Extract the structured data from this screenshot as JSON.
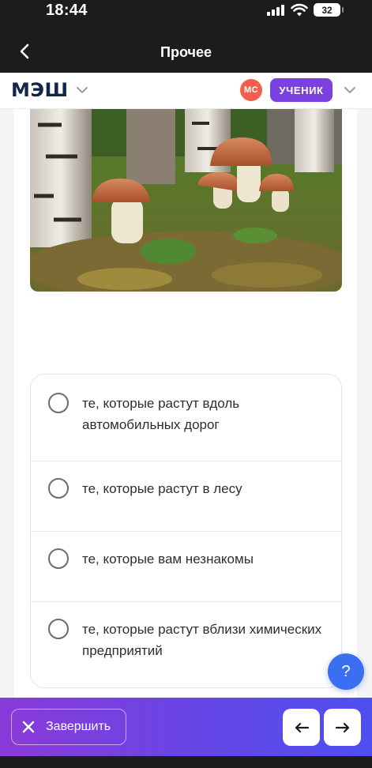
{
  "status_bar": {
    "time": "18:44",
    "battery": "32",
    "icons": [
      "signal-icon",
      "wifi-icon",
      "battery-icon"
    ]
  },
  "navbar": {
    "title": "Прочее",
    "back_icon": "chevron-left-icon"
  },
  "app_header": {
    "logo": "МЭШ",
    "logo_menu_icon": "chevron-down-icon",
    "avatar_initials": "МС",
    "role": "УЧЕНИК",
    "role_menu_icon": "chevron-down-icon"
  },
  "question": {
    "image": "mushrooms-photo",
    "options": [
      {
        "label": "те, которые растут вдоль автомобильных дорог"
      },
      {
        "label": "те, которые растут в лесу"
      },
      {
        "label": "те, которые вам незнакомы"
      },
      {
        "label": "те, которые растут вблизи химических предприятий"
      }
    ]
  },
  "help_button": {
    "label": "?"
  },
  "bottom_bar": {
    "finish_label": "Завершить",
    "finish_icon": "close-icon",
    "prev_icon": "arrow-left-icon",
    "next_icon": "arrow-right-icon"
  },
  "colors": {
    "accent": "#7a40e0",
    "avatar": "#f25f4c",
    "help": "#3a6ff2",
    "bar_start": "#8a3ad8",
    "bar_end": "#4f4ff0"
  }
}
